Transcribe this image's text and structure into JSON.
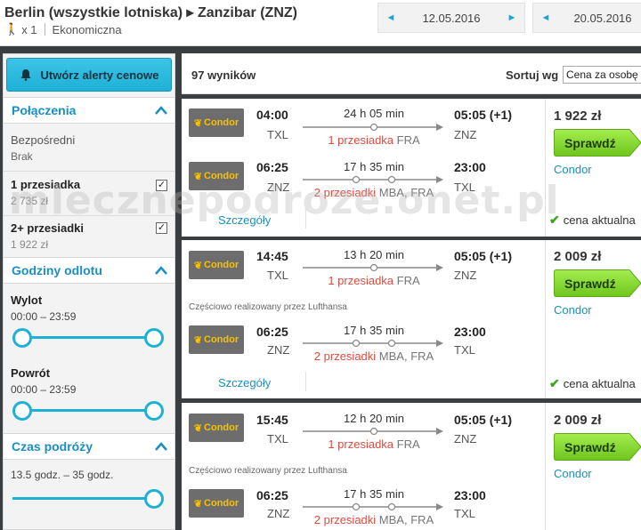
{
  "search": {
    "route": "Berlin (wszystkie lotniska) ▸ Zanzibar (ZNZ)",
    "passengers": "x 1",
    "cabin_class": "Ekonomiczna",
    "depart_date": "12.05.2016",
    "return_date": "20.05.2016",
    "prev_arrow": "◄",
    "next_arrow": "►"
  },
  "sidebar": {
    "alert_button": "Utwórz alerty cenowe",
    "connections": {
      "title": "Połączenia",
      "direct_label": "Bezpośredni",
      "direct_value": "Brak",
      "one_stop_label": "1 przesiadka",
      "one_stop_price": "2 735 zł",
      "one_stop_checked": true,
      "two_stop_label": "2+ przesiadki",
      "two_stop_price": "1 922 zł",
      "two_stop_checked": true
    },
    "departure_times": {
      "title": "Godziny odlotu",
      "outbound_label": "Wylot",
      "outbound_range": "00:00 – 23:59",
      "return_label": "Powrót",
      "return_range": "00:00 – 23:59"
    },
    "duration": {
      "title": "Czas podróży",
      "range": "13.5 godz. – 35 godz."
    }
  },
  "results": {
    "count": "97 wyników",
    "sort_label": "Sortuj wg",
    "sort_value": "Cena za osobę",
    "cards": [
      {
        "price": "1 922 zł",
        "button": "Sprawdź",
        "provider": "Condor",
        "current_price": "cena aktualna",
        "details": "Szczegóły",
        "outbound": {
          "airline": "Condor",
          "dep_time": "04:00",
          "dep_airport": "TXL",
          "duration": "24 h 05 min",
          "stops_count": "1 przesiadka",
          "stops_via": "FRA",
          "arr_time": "05:05 (+1)",
          "arr_airport": "ZNZ"
        },
        "inbound": {
          "airline": "Condor",
          "dep_time": "06:25",
          "dep_airport": "ZNZ",
          "duration": "17 h 35 min",
          "stops_count": "2 przesiadki",
          "stops_via": "MBA, FRA",
          "arr_time": "23:00",
          "arr_airport": "TXL"
        }
      },
      {
        "price": "2 009 zł",
        "button": "Sprawdź",
        "provider": "Condor",
        "current_price": "cena aktualna",
        "details": "Szczegóły",
        "operated_by": "Częściowo realizowany przez Lufthansa",
        "outbound": {
          "airline": "Condor",
          "dep_time": "14:45",
          "dep_airport": "TXL",
          "duration": "13 h 20 min",
          "stops_count": "1 przesiadka",
          "stops_via": "FRA",
          "arr_time": "05:05 (+1)",
          "arr_airport": "ZNZ"
        },
        "inbound": {
          "airline": "Condor",
          "dep_time": "06:25",
          "dep_airport": "ZNZ",
          "duration": "17 h 35 min",
          "stops_count": "2 przesiadki",
          "stops_via": "MBA, FRA",
          "arr_time": "23:00",
          "arr_airport": "TXL"
        }
      },
      {
        "price": "2 009 zł",
        "button": "Sprawdź",
        "provider": "Condor",
        "operated_by": "Częściowo realizowany przez Lufthansa",
        "outbound": {
          "airline": "Condor",
          "dep_time": "15:45",
          "dep_airport": "TXL",
          "duration": "12 h 20 min",
          "stops_count": "1 przesiadka",
          "stops_via": "FRA",
          "arr_time": "05:05 (+1)",
          "arr_airport": "ZNZ"
        },
        "inbound": {
          "airline": "Condor",
          "dep_time": "06:25",
          "dep_airport": "ZNZ",
          "duration": "17 h 35 min",
          "stops_count": "2 przesiadki",
          "stops_via": "MBA, FRA",
          "arr_time": "23:00",
          "arr_airport": "TXL"
        }
      }
    ]
  },
  "watermark": "mlecznepodroze.onet.pl",
  "colors": {
    "accent": "#1fb0d6",
    "link": "#1a8fc2",
    "button_green": "#8ee038",
    "stops_red": "#e04a3d",
    "check_green": "#3ea31c"
  }
}
